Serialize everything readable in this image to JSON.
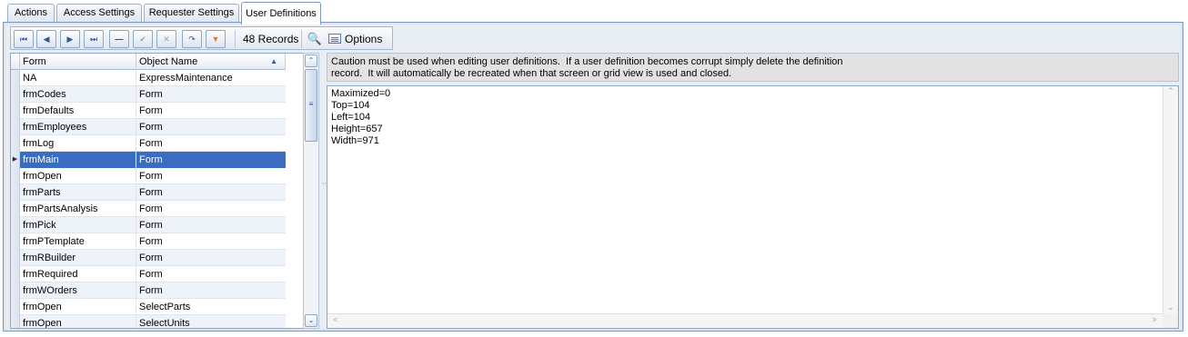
{
  "tabs": [
    {
      "label": "Actions",
      "active": false
    },
    {
      "label": "Access Settings",
      "active": false
    },
    {
      "label": "Requester Settings",
      "active": false
    },
    {
      "label": "User Definitions",
      "active": true
    }
  ],
  "toolbar": {
    "first_icon": "⏮",
    "prev_icon": "◀",
    "next_icon": "▶",
    "last_icon": "⏭",
    "delete_icon": "—",
    "post_icon": "✔",
    "cancel_icon": "✕",
    "refresh_icon": "↷",
    "filter_icon": "▼",
    "record_count": "48 Records",
    "search_icon": "🔍",
    "options_label": "Options",
    "options_caret": "▼"
  },
  "grid": {
    "columns": [
      "Form",
      "Object Name"
    ],
    "sort_indicator": "▲",
    "current_row_marker": "▶",
    "selected_index": 5,
    "rows": [
      {
        "form": "NA",
        "object": "ExpressMaintenance"
      },
      {
        "form": "frmCodes",
        "object": "Form"
      },
      {
        "form": "frmDefaults",
        "object": "Form"
      },
      {
        "form": "frmEmployees",
        "object": "Form"
      },
      {
        "form": "frmLog",
        "object": "Form"
      },
      {
        "form": "frmMain",
        "object": "Form"
      },
      {
        "form": "frmOpen",
        "object": "Form"
      },
      {
        "form": "frmParts",
        "object": "Form"
      },
      {
        "form": "frmPartsAnalysis",
        "object": "Form"
      },
      {
        "form": "frmPick",
        "object": "Form"
      },
      {
        "form": "frmPTemplate",
        "object": "Form"
      },
      {
        "form": "frmRBuilder",
        "object": "Form"
      },
      {
        "form": "frmRequired",
        "object": "Form"
      },
      {
        "form": "frmWOrders",
        "object": "Form"
      },
      {
        "form": "frmOpen",
        "object": "SelectParts"
      },
      {
        "form": "frmOpen",
        "object": "SelectUnits"
      }
    ]
  },
  "scrollbar": {
    "up": "⌃",
    "down": "⌄",
    "thumb_grip": "≡"
  },
  "splitter_grip": "⋮",
  "caution_text": "Caution must be used when editing user definitions.  If a user definition becomes corrupt simply delete the definition\nrecord.  It will automatically be recreated when that screen or grid view is used and closed.",
  "memo": {
    "text": "Maximized=0\nTop=104\nLeft=104\nHeight=657\nWidth=971",
    "scroll_up": "⌃",
    "scroll_down": "⌄",
    "scroll_left": "<",
    "scroll_right": ">"
  },
  "colors": {
    "selection": "#3a6cc0",
    "accent": "#2c58a0",
    "border": "#7d98bf"
  }
}
